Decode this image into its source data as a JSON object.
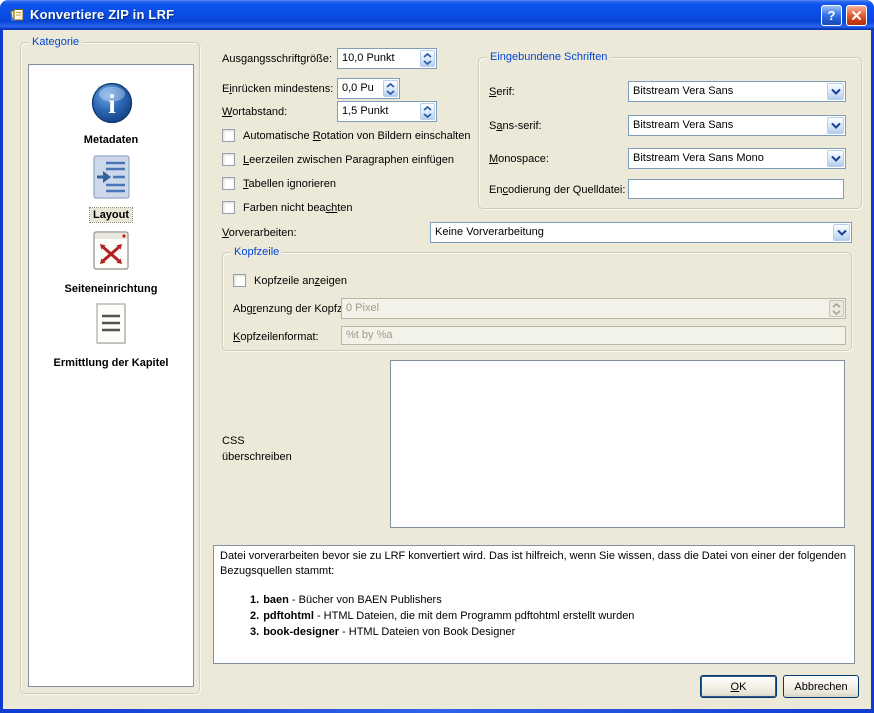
{
  "window": {
    "title": "Konvertiere ZIP in LRF",
    "help_glyph": "?"
  },
  "sidebar": {
    "group_title": "Kategorie",
    "items": [
      {
        "label": "Metadaten",
        "icon": "info-icon",
        "selected": false
      },
      {
        "label": "Layout",
        "icon": "layout-icon",
        "selected": true
      },
      {
        "label": "Seiteneinrichtung",
        "icon": "page-setup-icon",
        "selected": false
      },
      {
        "label": "Ermittlung der Kapitel",
        "icon": "chapter-list-icon",
        "selected": false
      }
    ]
  },
  "form": {
    "rows": [
      {
        "label": {
          "pre": "Ausgangsschrift",
          "key": "g",
          "post": "röße:"
        },
        "value": "10,0 Punkt"
      },
      {
        "label": {
          "pre": "E",
          "key": "i",
          "post": "nrücken mindestens:"
        },
        "value": "0,0 Pu"
      },
      {
        "label": {
          "pre": "",
          "key": "W",
          "post": "ortabstand:"
        },
        "value": "1,5 Punkt"
      }
    ],
    "checkboxes": [
      {
        "pre": "Automatische ",
        "key": "R",
        "post": "otation von Bildern einschalten"
      },
      {
        "pre": "",
        "key": "L",
        "post": "eerzeilen zwischen Paragraphen einfügen"
      },
      {
        "pre": "",
        "key": "T",
        "post": "abellen ignorieren"
      },
      {
        "pre": "Farben nicht bea",
        "key": "ch",
        "post": "ten"
      }
    ],
    "preprocess": {
      "label": {
        "pre": "",
        "key": "V",
        "post": "orverarbeiten:"
      },
      "value": "Keine Vorverarbeitung"
    }
  },
  "fonts_group": {
    "title": "Eingebundene Schriften",
    "serif": {
      "label": {
        "pre": "",
        "key": "S",
        "post": "erif:"
      },
      "value": "Bitstream Vera Sans"
    },
    "sans": {
      "label": {
        "pre": "S",
        "key": "a",
        "post": "ns-serif:"
      },
      "value": "Bitstream Vera Sans"
    },
    "mono": {
      "label": {
        "pre": "",
        "key": "M",
        "post": "onospace:"
      },
      "value": "Bitstream Vera Sans Mono"
    },
    "encoding": {
      "label": {
        "pre": "En",
        "key": "c",
        "post": "odierung der Quelldatei:"
      },
      "value": ""
    }
  },
  "header_group": {
    "title": "Kopfzeile",
    "show_checkbox": {
      "pre": "Kopfzeile an",
      "key": "z",
      "post": "eigen"
    },
    "separation": {
      "label": {
        "pre": "Abg",
        "key": "r",
        "post": "enzung der Kopfzeile:"
      },
      "value": "0 Pixel"
    },
    "format": {
      "label": {
        "pre": "",
        "key": "K",
        "post": "opfzeilenformat:"
      },
      "value": "%t by %a"
    }
  },
  "css_section": {
    "label_line1": "CSS",
    "label_line2": "überschreiben",
    "value": ""
  },
  "info": {
    "intro": "Datei vorverarbeiten bevor sie zu LRF konvertiert wird. Das ist hilfreich, wenn Sie wissen, dass die Datei von einer der folgenden Bezugsquellen stammt:",
    "items": [
      {
        "num": "1.",
        "name": "baen",
        "desc": " - Bücher von BAEN Publishers"
      },
      {
        "num": "2.",
        "name": "pdftohtml",
        "desc": " - HTML Dateien, die mit dem Programm pdftohtml erstellt wurden"
      },
      {
        "num": "3.",
        "name": "book-designer",
        "desc": " - HTML Dateien von Book Designer"
      }
    ]
  },
  "buttons": {
    "ok": {
      "pre": "",
      "key": "O",
      "post": "K"
    },
    "cancel": "Abbrechen"
  },
  "colors": {
    "titlebar_blue": "#0b51ec",
    "client_bg": "#ECE9D8",
    "group_title_blue": "#0046D5",
    "field_border": "#7F9DB9"
  }
}
